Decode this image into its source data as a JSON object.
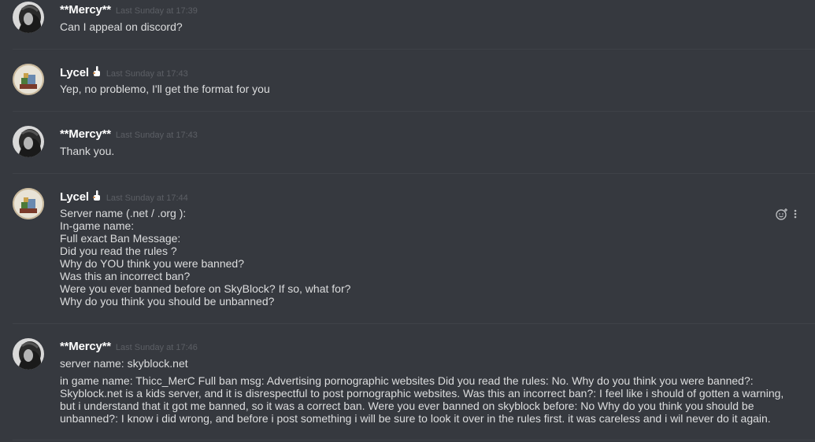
{
  "channel": {
    "messages": [
      {
        "author": "**Mercy**",
        "timestamp": "Last Sunday at 17:39",
        "lines": [
          "Can I appeal on discord?"
        ]
      },
      {
        "author": "Lycel",
        "author_badge": "hand-icon",
        "timestamp": "Last Sunday at 17:43",
        "lines": [
          "Yep, no problemo, I'll get the format for you"
        ]
      },
      {
        "author": "**Mercy**",
        "timestamp": "Last Sunday at 17:43",
        "lines": [
          "Thank you."
        ]
      },
      {
        "author": "Lycel",
        "author_badge": "hand-icon",
        "timestamp": "Last Sunday at 17:44",
        "lines": [
          "Server name (.net / .org ):",
          "In-game name:",
          "Full exact Ban Message:",
          "Did you read the rules ?",
          "Why do YOU think you were banned?",
          "Was this an incorrect ban?",
          "Were you ever banned before on SkyBlock? If so, what for?",
          "Why do you think you should be unbanned?"
        ]
      },
      {
        "author": "**Mercy**",
        "timestamp": "Last Sunday at 17:46",
        "lines": [
          "server name: skyblock.net",
          "in game name: Thicc_MerC     Full ban msg: Advertising pornographic websites    Did you read the rules: No. Why do you think you were banned?: Skyblock.net is a kids server, and it is disrespectful to post pornographic websites. Was this an incorrect ban?: I feel like i should of gotten a warning, but i understand that it got me banned, so it was a correct ban.  Were you ever banned on skyblock before: No   Why do you think you should be unbanned?: I know i did wrong, and before i post something i will be sure to look it over in the rules first. it was careless and i wil never do it again."
        ]
      }
    ],
    "hover_actions": [
      "add-reaction-icon",
      "more-options-icon"
    ]
  },
  "colors": {
    "background": "#36393f",
    "username": "#ffffff",
    "text": "#dcddde",
    "timestamp": "#5c5f65",
    "divider": "#3f4248"
  }
}
